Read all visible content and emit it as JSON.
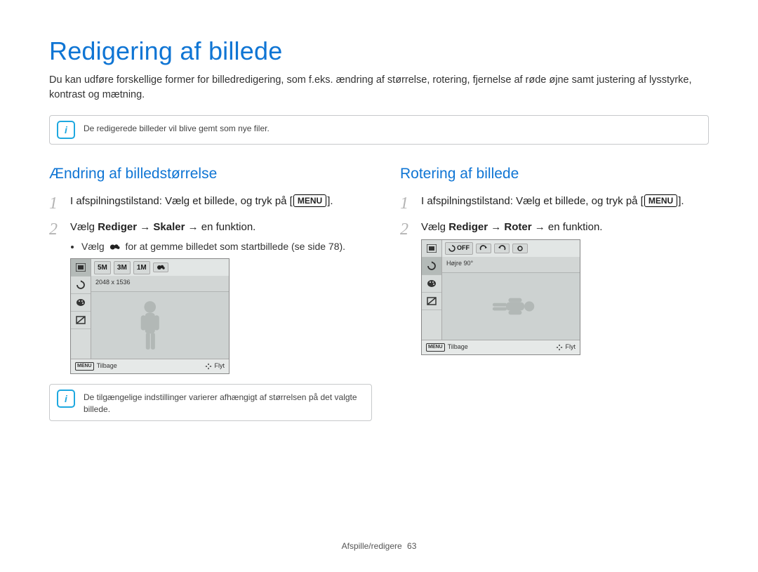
{
  "title": "Redigering af billede",
  "intro": "Du kan udføre forskellige former for billedredigering, som f.eks. ændring af størrelse, rotering, fjernelse af røde øjne samt justering af lysstyrke, kontrast og mætning.",
  "note_top": "De redigerede billeder vil blive gemt som nye filer.",
  "left": {
    "heading": "Ændring af billedstørrelse",
    "step1_a": "I afspilningstilstand: Vælg et billede, og tryk på [",
    "step1_b": "MENU",
    "step1_c": "].",
    "step2_a": "Vælg ",
    "step2_b": "Rediger",
    "step2_c": " → ",
    "step2_d": "Skaler",
    "step2_e": " → en funktion.",
    "bullet_a": "Vælg ",
    "bullet_b": " for at gemme billedet som startbillede (se side 78).",
    "lcd": {
      "info": "2048 x 1536",
      "back": "Tilbage",
      "move": "Flyt",
      "top_chips": [
        "5M",
        "3M",
        "1M"
      ]
    },
    "note_bottom": "De tilgængelige indstillinger varierer afhængigt af størrelsen på det valgte billede."
  },
  "right": {
    "heading": "Rotering af billede",
    "step1_a": "I afspilningstilstand: Vælg et billede, og tryk på [",
    "step1_b": "MENU",
    "step1_c": "].",
    "step2_a": "Vælg ",
    "step2_b": "Rediger",
    "step2_c": " → ",
    "step2_d": "Roter",
    "step2_e": " → en funktion.",
    "lcd": {
      "info": "Højre 90°",
      "back": "Tilbage",
      "move": "Flyt",
      "top_chip_off": "OFF"
    }
  },
  "footer": {
    "section": "Afspille/redigere",
    "page": "63"
  }
}
